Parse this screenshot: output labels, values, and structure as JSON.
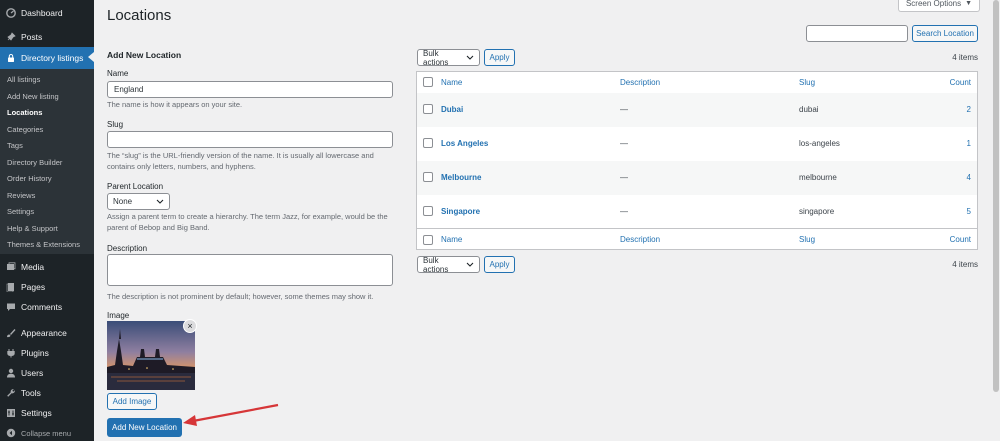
{
  "sidebar": {
    "top_items": [
      {
        "label": "Dashboard",
        "icon": "dashboard-icon"
      },
      {
        "label": "Posts",
        "icon": "pin-icon"
      },
      {
        "label": "Directory listings",
        "icon": "lock-icon"
      }
    ],
    "submenu": [
      "All listings",
      "Add New listing",
      "Locations",
      "Categories",
      "Tags",
      "Directory Builder",
      "Order History",
      "Reviews",
      "Settings",
      "Help & Support",
      "Themes & Extensions"
    ],
    "bottom_items": [
      {
        "label": "Media",
        "icon": "media-icon"
      },
      {
        "label": "Pages",
        "icon": "pages-icon"
      },
      {
        "label": "Comments",
        "icon": "comment-icon"
      },
      {
        "label": "Appearance",
        "icon": "brush-icon"
      },
      {
        "label": "Plugins",
        "icon": "plug-icon"
      },
      {
        "label": "Users",
        "icon": "user-icon"
      },
      {
        "label": "Tools",
        "icon": "wrench-icon"
      },
      {
        "label": "Settings",
        "icon": "sliders-icon"
      },
      {
        "label": "Collapse menu",
        "icon": "collapse-icon"
      }
    ]
  },
  "header": {
    "title": "Locations",
    "screen_options": "Screen Options"
  },
  "form": {
    "heading": "Add New Location",
    "name_label": "Name",
    "name_value": "England",
    "name_desc": "The name is how it appears on your site.",
    "slug_label": "Slug",
    "slug_value": "",
    "slug_desc_1": "The “slug” is the URL-friendly version of the name. It is usually all lowercase and",
    "slug_desc_2": "contains only letters, numbers, and hyphens.",
    "parent_label": "Parent Location",
    "parent_value": "None",
    "parent_desc_1": "Assign a parent term to create a hierarchy. The term Jazz, for example, would be the",
    "parent_desc_2": "parent of Bebop and Big Band.",
    "description_label": "Description",
    "description_desc": "The description is not prominent by default; however, some themes may show it.",
    "image_label": "Image",
    "add_image_button": "Add Image",
    "submit_button": "Add New Location"
  },
  "list": {
    "search_button": "Search Location",
    "bulk_actions": "Bulk actions",
    "apply": "Apply",
    "items_count": "4 items",
    "columns": {
      "name": "Name",
      "description": "Description",
      "slug": "Slug",
      "count": "Count"
    },
    "rows": [
      {
        "name": "Dubai",
        "description": "—",
        "slug": "dubai",
        "count": "2"
      },
      {
        "name": "Los Angeles",
        "description": "—",
        "slug": "los-angeles",
        "count": "1"
      },
      {
        "name": "Melbourne",
        "description": "—",
        "slug": "melbourne",
        "count": "4"
      },
      {
        "name": "Singapore",
        "description": "—",
        "slug": "singapore",
        "count": "5"
      }
    ]
  },
  "colors": {
    "sidebar_bg": "#1d2327",
    "accent": "#2271b1",
    "annotation_arrow": "#d63638"
  }
}
